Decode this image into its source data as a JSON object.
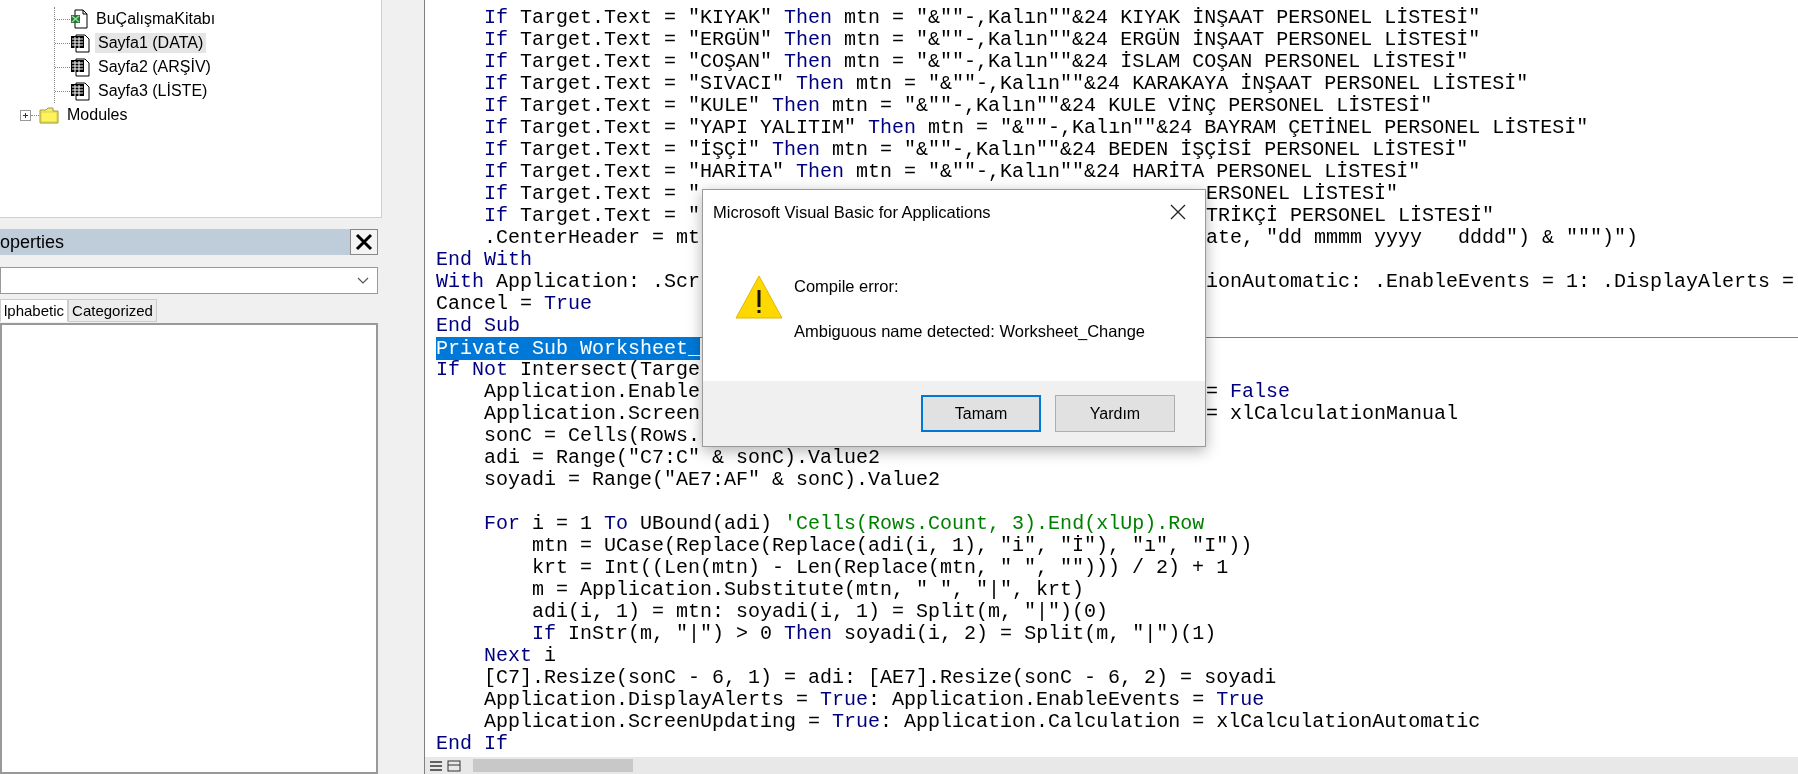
{
  "project_tree": {
    "items": [
      {
        "kind": "group",
        "children": [
          {
            "kind": "workbook",
            "label": "BuÇalışmaKitabı",
            "selected": false
          },
          {
            "kind": "sheet",
            "label": "Sayfa1 (DATA)",
            "selected": true
          },
          {
            "kind": "sheet",
            "label": "Sayfa2 (ARŞİV)",
            "selected": false
          },
          {
            "kind": "sheet",
            "label": "Sayfa3 (LİSTE)",
            "selected": false
          }
        ]
      },
      {
        "kind": "folder",
        "label": "Modules",
        "expanded": false,
        "selected": false
      }
    ]
  },
  "properties_window": {
    "title": "operties",
    "tabs": [
      {
        "label": "lphabetic",
        "selected": true
      },
      {
        "label": "Categorized",
        "selected": false
      }
    ]
  },
  "code_window": {
    "lines": [
      {
        "kind": "code",
        "left": [
          {
            "kind": "keyword",
            "text": "    If"
          },
          " Target.Text = \"KIYAK\" ",
          {
            "kind": "keyword",
            "text": "Then"
          },
          " mtn = \"&\"\"-,Kalın\"\"&24 KIYAK İNŞAAT PERSONEL LİSTESİ\""
        ]
      },
      {
        "kind": "code",
        "left": [
          {
            "kind": "keyword",
            "text": "    If"
          },
          " Target.Text = \"ERGÜN\" ",
          {
            "kind": "keyword",
            "text": "Then"
          },
          " mtn = \"&\"\"-,Kalın\"\"&24 ERGÜN İNŞAAT PERSONEL LİSTESİ\""
        ]
      },
      {
        "kind": "code",
        "left": [
          {
            "kind": "keyword",
            "text": "    If"
          },
          " Target.Text = \"COŞAN\" ",
          {
            "kind": "keyword",
            "text": "Then"
          },
          " mtn = \"&\"\"-,Kalın\"\"&24 İSLAM COŞAN PERSONEL LİSTESİ\""
        ]
      },
      {
        "kind": "code",
        "left": [
          {
            "kind": "keyword",
            "text": "    If"
          },
          " Target.Text = \"SIVACI\" ",
          {
            "kind": "keyword",
            "text": "Then"
          },
          " mtn = \"&\"\"-,Kalın\"\"&24 KARAKAYA İNŞAAT PERSONEL LİSTESİ\""
        ]
      },
      {
        "kind": "code",
        "left": [
          {
            "kind": "keyword",
            "text": "    If"
          },
          " Target.Text = \"KULE\" ",
          {
            "kind": "keyword",
            "text": "Then"
          },
          " mtn = \"&\"\"-,Kalın\"\"&24 KULE VİNÇ PERSONEL LİSTESİ\""
        ]
      },
      {
        "kind": "code",
        "left": [
          {
            "kind": "keyword",
            "text": "    If"
          },
          " Target.Text = \"YAPI YALITIM\" ",
          {
            "kind": "keyword",
            "text": "Then"
          },
          " mtn = \"&\"\"-,Kalın\"\"&24 BAYRAM ÇETİNEL PERSONEL LİSTESİ\""
        ]
      },
      {
        "kind": "code",
        "left": [
          {
            "kind": "keyword",
            "text": "    If"
          },
          " Target.Text = \"İŞÇİ\" ",
          {
            "kind": "keyword",
            "text": "Then"
          },
          " mtn = \"&\"\"-,Kalın\"\"&24 BEDEN İŞÇİSİ PERSONEL LİSTESİ\""
        ]
      },
      {
        "kind": "code",
        "left": [
          {
            "kind": "keyword",
            "text": "    If"
          },
          " Target.Text = \"HARİTA\" ",
          {
            "kind": "keyword",
            "text": "Then"
          },
          " mtn = \"&\"\"-,Kalın\"\"&24 HARİTA PERSONEL LİSTESİ\""
        ]
      },
      {
        "kind": "code",
        "left": [
          {
            "kind": "keyword",
            "text": "    If"
          },
          " Target.Text = \""
        ],
        "right": [
          "ERSONEL LİSTESİ\""
        ]
      },
      {
        "kind": "code",
        "left": [
          {
            "kind": "keyword",
            "text": "    If"
          },
          " Target.Text = \""
        ],
        "right": [
          "TRİKÇİ PERSONEL LİSTESİ\""
        ]
      },
      {
        "kind": "code",
        "left": [
          "    .CenterHeader = mt"
        ],
        "right": [
          "ate, \"dd mmmm yyyy   dddd\") & \"\"\")\")"
        ]
      },
      {
        "kind": "code",
        "left": [
          {
            "kind": "keyword",
            "text": "End With"
          }
        ]
      },
      {
        "kind": "code",
        "left": [
          {
            "kind": "keyword",
            "text": "With"
          },
          " Application: .Scr"
        ],
        "right": [
          "ionAutomatic: .EnableEvents = 1: .DisplayAlerts ="
        ]
      },
      {
        "kind": "code",
        "left": [
          "Cancel = ",
          {
            "kind": "keyword",
            "text": "True"
          }
        ]
      },
      {
        "kind": "code",
        "left": [
          {
            "kind": "keyword",
            "text": "End Sub"
          }
        ]
      },
      {
        "kind": "code",
        "procedure_start": true,
        "left": [
          {
            "kind": "selected",
            "text": "Private Sub Worksheet_"
          }
        ]
      },
      {
        "kind": "code",
        "left": [
          {
            "kind": "keyword",
            "text": "If Not"
          },
          " Intersect(Targe"
        ]
      },
      {
        "kind": "code",
        "left": [
          "    Application.Enable"
        ],
        "right": [
          "= ",
          {
            "kind": "keyword",
            "text": "False"
          }
        ]
      },
      {
        "kind": "code",
        "left": [
          "    Application.Screen"
        ],
        "right": [
          "= xlCalculationManual"
        ]
      },
      {
        "kind": "code",
        "left": [
          "    sonC = Cells(Rows."
        ]
      },
      {
        "kind": "code",
        "left": [
          "    adi = Range(\"C7:C\" & sonC).Value2"
        ]
      },
      {
        "kind": "code",
        "left": [
          "    soyadi = Range(\"AE7:AF\" & sonC).Value2"
        ]
      },
      {
        "kind": "blank"
      },
      {
        "kind": "code",
        "left": [
          {
            "kind": "keyword",
            "text": "    For"
          },
          " i = 1 ",
          {
            "kind": "keyword",
            "text": "To"
          },
          " UBound(adi) ",
          {
            "kind": "comment",
            "text": "'Cells(Rows.Count, 3).End(xlUp).Row"
          }
        ]
      },
      {
        "kind": "code",
        "left": [
          "        mtn = UCase(Replace(Replace(adi(i, 1), \"i\", \"İ\"), \"ı\", \"I\"))"
        ]
      },
      {
        "kind": "code",
        "left": [
          "        krt = Int((Len(mtn) - Len(Replace(mtn, \" \", \"\"))) / 2) + 1"
        ]
      },
      {
        "kind": "code",
        "left": [
          "        m = Application.Substitute(mtn, \" \", \"|\", krt)"
        ]
      },
      {
        "kind": "code",
        "left": [
          "        adi(i, 1) = mtn: soyadi(i, 1) = Split(m, \"|\")(0)"
        ]
      },
      {
        "kind": "code",
        "left": [
          {
            "kind": "keyword",
            "text": "        If"
          },
          " InStr(m, \"|\") > 0 ",
          {
            "kind": "keyword",
            "text": "Then"
          },
          " soyadi(i, 2) = Split(m, \"|\")(1)"
        ]
      },
      {
        "kind": "code",
        "left": [
          {
            "kind": "keyword",
            "text": "    Next"
          },
          " i"
        ]
      },
      {
        "kind": "code",
        "left": [
          "    [C7].Resize(sonC - 6, 1) = adi: [AE7].Resize(sonC - 6, 2) = soyadi"
        ]
      },
      {
        "kind": "code",
        "left": [
          "    Application.DisplayAlerts = ",
          {
            "kind": "keyword",
            "text": "True"
          },
          ": Application.EnableEvents = ",
          {
            "kind": "keyword",
            "text": "True"
          }
        ]
      },
      {
        "kind": "code",
        "left": [
          "    Application.ScreenUpdating = ",
          {
            "kind": "keyword",
            "text": "True"
          },
          ": Application.Calculation = xlCalculationAutomatic"
        ]
      },
      {
        "kind": "code",
        "left": [
          {
            "kind": "keyword",
            "text": "End If"
          }
        ]
      }
    ]
  },
  "dialog": {
    "title": "Microsoft Visual Basic for Applications",
    "heading": "Compile error:",
    "message": "Ambiguous name detected: Worksheet_Change",
    "buttons": [
      {
        "label": "Tamam",
        "default": true
      },
      {
        "label": "Yardım",
        "default": false
      }
    ]
  }
}
